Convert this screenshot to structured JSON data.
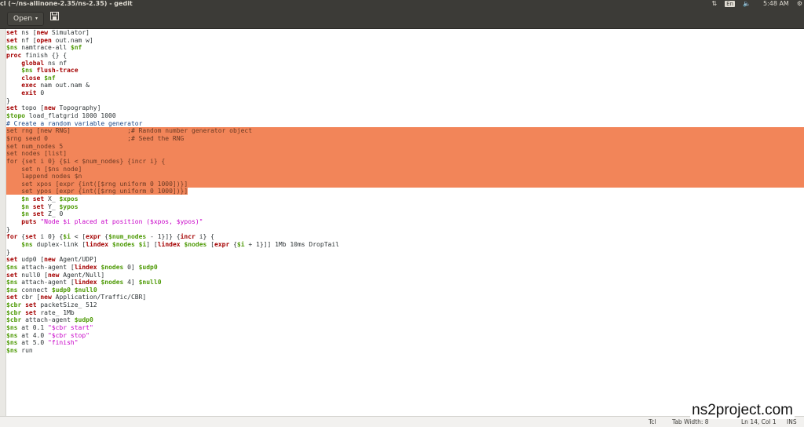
{
  "window": {
    "title": "cl (~/ns-allinone-2.35/ns-2.35) - gedit"
  },
  "tray": {
    "network_icon": "network-icon",
    "keyboard_layout": "En",
    "volume_icon": "volume-icon",
    "clock": "5:48 AM",
    "settings_icon": "gear-icon"
  },
  "toolbar": {
    "open_label": "Open",
    "open_caret": "▾",
    "save_icon": "save-icon"
  },
  "editor": {
    "lines": [
      "set ns [new Simulator]",
      "set nf [open out.nam w]",
      "$ns namtrace-all $nf",
      "proc finish {} {",
      "    global ns nf",
      "    $ns flush-trace",
      "    close $nf",
      "    exec nam out.nam &",
      "    exit 0",
      "}",
      "set topo [new Topography]",
      "$topo load_flatgrid 1000 1000",
      "# Create a random variable generator",
      "set rng [new RNG]               ;# Random number generator object",
      "$rng seed 0                     ;# Seed the RNG",
      "set num_nodes 5",
      "set nodes [list]",
      "for {set i 0} {$i < $num_nodes} {incr i} {",
      "    set n [$ns node]",
      "    lappend nodes $n",
      "    set xpos [expr {int([$rng uniform 0 1000])}]",
      "    set ypos [expr {int([$rng uniform 0 1000])}]",
      "    $n set X_ $xpos",
      "    $n set Y_ $ypos",
      "    $n set Z_ 0",
      "    puts \"Node $i placed at position ($xpos, $ypos)\"",
      "}",
      "for {set i 0} {$i < [expr {$num_nodes - 1}]} {incr i} {",
      "    $ns duplex-link [lindex $nodes $i] [lindex $nodes [expr {$i + 1}]] 1Mb 10ms DropTail",
      "}",
      "set udp0 [new Agent/UDP]",
      "$ns attach-agent [lindex $nodes 0] $udp0",
      "set null0 [new Agent/Null]",
      "$ns attach-agent [lindex $nodes 4] $null0",
      "$ns connect $udp0 $null0",
      "set cbr [new Application/Traffic/CBR]",
      "$cbr set packetSize_ 512",
      "$cbr set rate_ 1Mb",
      "$cbr attach-agent $udp0",
      "$ns at 0.1 \"$cbr start\"",
      "$ns at 4.0 \"$cbr stop\"",
      "$ns at 5.0 \"finish\"",
      "$ns run"
    ],
    "selected_full_lines": [
      13,
      14,
      15,
      16,
      17,
      18,
      19,
      20
    ],
    "selected_partial_line": 21
  },
  "statusbar": {
    "language": "Tcl",
    "tab_width": "Tab Width: 8",
    "position": "Ln 14, Col 1",
    "mode": "INS"
  },
  "watermark": "ns2project.com",
  "colors": {
    "selection": "#f28559",
    "keyword": "#a40000",
    "variable": "#4e9a06",
    "string": "#c800c8",
    "comment": "#204a87",
    "chrome": "#3c3b37"
  }
}
